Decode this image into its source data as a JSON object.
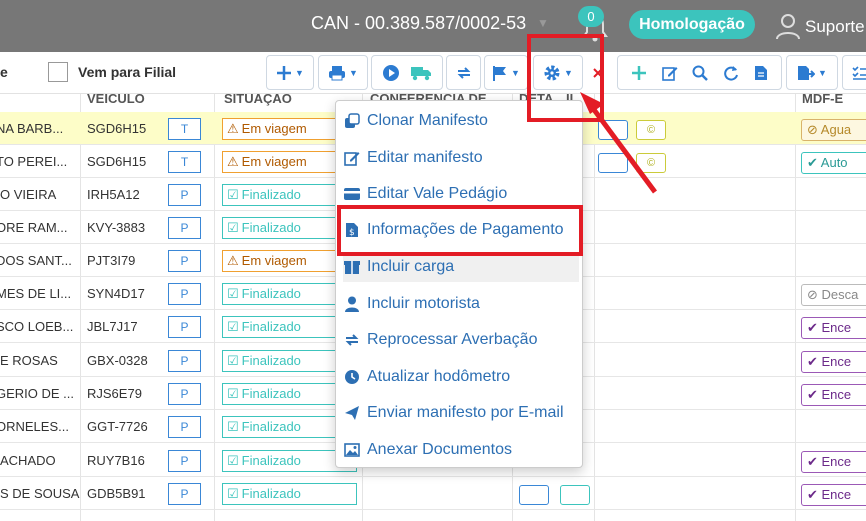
{
  "header": {
    "company": "CAN - 00.389.587/0002-53",
    "notifications": "0",
    "environment": "Homologação",
    "user": "Suporte"
  },
  "toolbar": {
    "left_label": "e",
    "checkbox_label": "Vem para Filial"
  },
  "columns": {
    "veiculo": "VEÍCULO",
    "situacao": "SITUAÇÃO",
    "conferencia": "CONFERÊNCIA DE ...",
    "deta": "DETA",
    "il": "IL",
    "mdfe": "MDF-E"
  },
  "rows": [
    {
      "name": "NA BARB...",
      "plate": "SGD6H15",
      "type": "T",
      "status": "Em viagem",
      "mdfe": "Agua",
      "highlight": true
    },
    {
      "name": "TO PEREI...",
      "plate": "SGD6H15",
      "type": "T",
      "status": "Em viagem",
      "mdfe": "Auto"
    },
    {
      "name": "O VIEIRA",
      "plate": "IRH5A12",
      "type": "P",
      "status": "Finalizado",
      "mdfe": ""
    },
    {
      "name": "ORE RAM...",
      "plate": "KVY-3883",
      "type": "P",
      "status": "Finalizado",
      "mdfe": ""
    },
    {
      "name": "DOS SANT...",
      "plate": "PJT3I79",
      "type": "P",
      "status": "Em viagem",
      "mdfe": ""
    },
    {
      "name": "MES DE LI...",
      "plate": "SYN4D17",
      "type": "P",
      "status": "Finalizado",
      "mdfe": "Desca"
    },
    {
      "name": "SCO LOEB...",
      "plate": "JBL7J17",
      "type": "P",
      "status": "Finalizado",
      "mdfe": "Ence"
    },
    {
      "name": "E ROSAS",
      "plate": "GBX-0328",
      "type": "P",
      "status": "Finalizado",
      "mdfe": "Ence"
    },
    {
      "name": "GERIO DE ...",
      "plate": "RJS6E79",
      "type": "P",
      "status": "Finalizado",
      "mdfe": "Ence"
    },
    {
      "name": "ORNELES...",
      "plate": "GGT-7726",
      "type": "P",
      "status": "Finalizado",
      "mdfe": ""
    },
    {
      "name": "ACHADO",
      "plate": "RUY7B16",
      "type": "P",
      "status": "Finalizado",
      "mdfe": "Ence"
    },
    {
      "name": "S DE SOUSA",
      "plate": "GDB5B91",
      "type": "P",
      "status": "Finalizado",
      "mdfe": "Ence"
    }
  ],
  "menu": [
    {
      "label": "Clonar Manifesto",
      "icon": "clone-icon"
    },
    {
      "label": "Editar manifesto",
      "icon": "edit-icon"
    },
    {
      "label": "Editar Vale Pedágio",
      "icon": "card-icon"
    },
    {
      "label": "Informações de Pagamento",
      "icon": "invoice-icon"
    },
    {
      "label": "Incluir carga",
      "icon": "box-icon"
    },
    {
      "label": "Incluir motorista",
      "icon": "user-icon"
    },
    {
      "label": "Reprocessar Averbação",
      "icon": "retweet-icon"
    },
    {
      "label": "Atualizar hodômetro",
      "icon": "clock-icon"
    },
    {
      "label": "Enviar manifesto por E-mail",
      "icon": "paper-plane-icon"
    },
    {
      "label": "Anexar Documentos",
      "icon": "image-icon"
    }
  ],
  "colors": {
    "accent": "#3cc4bd",
    "link": "#2d6fb3",
    "highlight": "#e31c25",
    "topbar": "#777777"
  }
}
